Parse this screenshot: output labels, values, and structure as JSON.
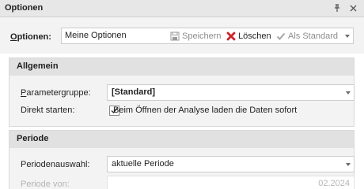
{
  "window": {
    "title": "Optionen"
  },
  "icons": {
    "pin": "pin-icon",
    "close": "close-icon",
    "save": "floppy-disk-icon",
    "delete": "red-x-icon",
    "default": "checkmark-icon",
    "dropdown": "chevron-down-icon"
  },
  "colors": {
    "delete_icon": "#d0222b",
    "panel_header": "#e1e1e1"
  },
  "options": {
    "label": "Optionen:",
    "value": "Meine Optionen",
    "save_label": "Speichern",
    "delete_label": "Löschen",
    "default_label": "Als Standard"
  },
  "general": {
    "header": "Allgemein",
    "param_label": "Parametergruppe:",
    "param_value": "[Standard]",
    "direct_label": "Direkt starten:",
    "direct_checked": true,
    "direct_text": "Beim Öffnen der Analyse laden die Daten sofort"
  },
  "period": {
    "header": "Periode",
    "select_label": "Periodenauswahl:",
    "select_value": "aktuelle Periode",
    "from_label": "Periode von:",
    "from_value": "02.2024"
  }
}
